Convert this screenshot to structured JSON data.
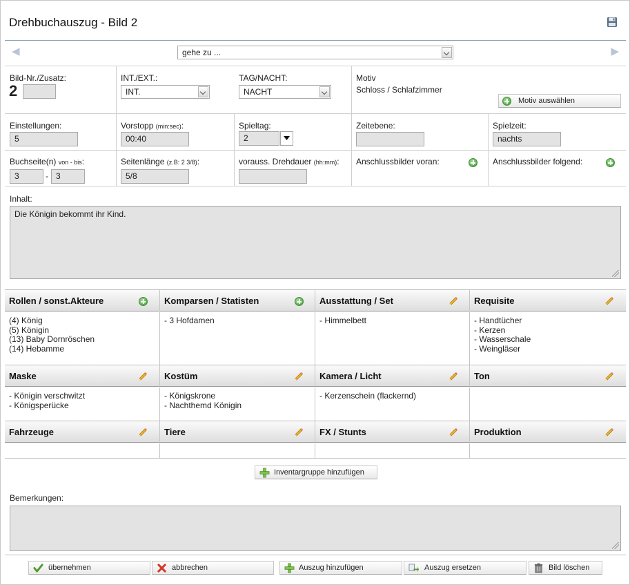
{
  "header": {
    "title": "Drehbuchauszug - Bild 2",
    "save_icon": "save-icon"
  },
  "nav": {
    "prev_icon": "arrow-left-icon",
    "next_icon": "arrow-right-icon",
    "goto_value": "gehe zu ..."
  },
  "row1": {
    "bild_label": "Bild-Nr./Zusatz:",
    "bild_number": "2",
    "bild_zusatz": "",
    "intext_label": "INT./EXT.:",
    "intext_value": "INT.",
    "tagnacht_label": "TAG/NACHT:",
    "tagnacht_value": "NACHT",
    "motiv_label": "Motiv",
    "motiv_value": "Schloss / Schlafzimmer",
    "motiv_button": "Motiv auswählen"
  },
  "row2": {
    "einstellungen_label": "Einstellungen:",
    "einstellungen_value": "5",
    "vorstopp_label": "Vorstopp",
    "vorstopp_unit": "(min:sec)",
    "vorstopp_colon": ":",
    "vorstopp_value": "00:40",
    "spieltag_label": "Spieltag:",
    "spieltag_value": "2",
    "zeitebene_label": "Zeitebene:",
    "zeitebene_value": "",
    "spielzeit_label": "Spielzeit:",
    "spielzeit_value": "nachts"
  },
  "row3": {
    "buchseite_label": "Buchseite(n)",
    "buchseite_unit": "von - bis",
    "buchseite_colon": ":",
    "buchseite_from": "3",
    "buchseite_sep": "-",
    "buchseite_to": "3",
    "seitenlaenge_label": "Seitenlänge",
    "seitenlaenge_unit": "(z.B: 2 3/8)",
    "seitenlaenge_colon": ":",
    "seitenlaenge_value": "5/8",
    "drehdauer_label": "vorauss. Drehdauer",
    "drehdauer_unit": "(hh:mm)",
    "drehdauer_colon": ":",
    "drehdauer_value": "",
    "anschluss_voran_label": "Anschlussbilder voran:",
    "anschluss_folgend_label": "Anschlussbilder folgend:"
  },
  "inhalt": {
    "label": "Inhalt:",
    "text": "Die Königin bekommt ihr Kind."
  },
  "categories_row1": [
    {
      "title": "Rollen / sonst.Akteure",
      "icon": "add-circle-icon",
      "items": [
        "(4) König",
        "(5) Königin",
        "(13) Baby Dornröschen",
        "(14) Hebamme"
      ]
    },
    {
      "title": "Komparsen / Statisten",
      "icon": "add-circle-icon",
      "items": [
        "- 3 Hofdamen"
      ]
    },
    {
      "title": "Ausstattung / Set",
      "icon": "pencil-icon",
      "items": [
        "- Himmelbett"
      ]
    },
    {
      "title": "Requisite",
      "icon": "pencil-icon",
      "items": [
        "- Handtücher",
        "- Kerzen",
        "- Wasserschale",
        "- Weingläser"
      ]
    }
  ],
  "categories_row2": [
    {
      "title": "Maske",
      "icon": "pencil-icon",
      "items": [
        "- Königin verschwitzt",
        "- Königsperücke"
      ]
    },
    {
      "title": "Kostüm",
      "icon": "pencil-icon",
      "items": [
        "- Königskrone",
        "- Nachthemd Königin"
      ]
    },
    {
      "title": "Kamera / Licht",
      "icon": "pencil-icon",
      "items": [
        "- Kerzenschein (flackernd)"
      ]
    },
    {
      "title": "Ton",
      "icon": "pencil-icon",
      "items": []
    }
  ],
  "categories_row3": [
    {
      "title": "Fahrzeuge",
      "icon": "pencil-icon",
      "items": []
    },
    {
      "title": "Tiere",
      "icon": "pencil-icon",
      "items": []
    },
    {
      "title": "FX / Stunts",
      "icon": "pencil-icon",
      "items": []
    },
    {
      "title": "Produktion",
      "icon": "pencil-icon",
      "items": []
    }
  ],
  "inventar_button": "Inventargruppe hinzufügen",
  "bemerkungen": {
    "label": "Bemerkungen:",
    "text": ""
  },
  "footer": {
    "uebernehmen": "übernehmen",
    "abbrechen": "abbrechen",
    "auszug_hinzufuegen": "Auszug hinzufügen",
    "auszug_ersetzen": "Auszug ersetzen",
    "bild_loeschen": "Bild löschen"
  }
}
